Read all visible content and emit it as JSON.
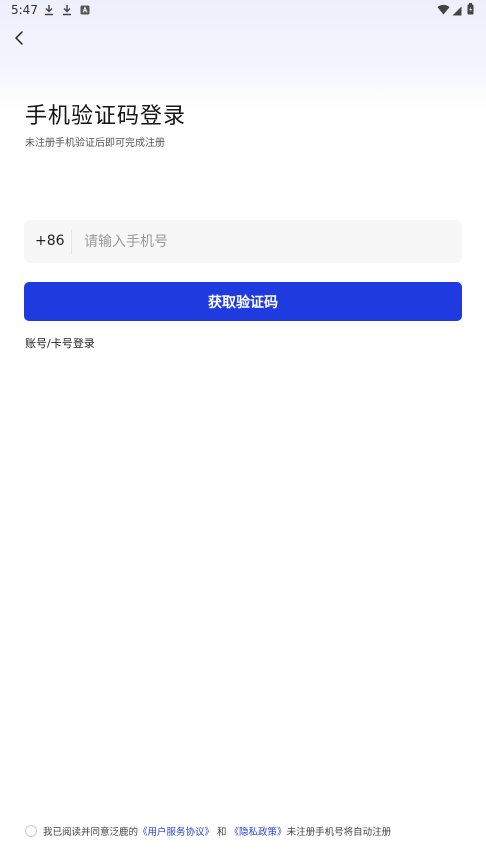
{
  "status_bar": {
    "time": "5:47",
    "icons": [
      "download-icon",
      "download-icon",
      "app-notification-icon",
      "wifi-icon",
      "signal-icon",
      "battery-icon"
    ]
  },
  "header": {
    "back_icon": "chevron-left-icon"
  },
  "login": {
    "title": "手机验证码登录",
    "subtitle": "未注册手机验证后即可完成注册",
    "country_code": "+86",
    "phone_placeholder": "请输入手机号",
    "phone_value": "",
    "get_code_label": "获取验证码",
    "account_login_label": "账号/卡号登录"
  },
  "agreement": {
    "prefix": "我已阅读并同意泛鹿的",
    "user_agreement": "《用户服务协议》",
    "and": "和",
    "privacy_policy": "《隐私政策》",
    "suffix": "未注册手机号将自动注册",
    "checked": false
  },
  "colors": {
    "primary": "#1f3be0",
    "link": "#2a43d6",
    "input_bg": "#f7f7f8"
  }
}
